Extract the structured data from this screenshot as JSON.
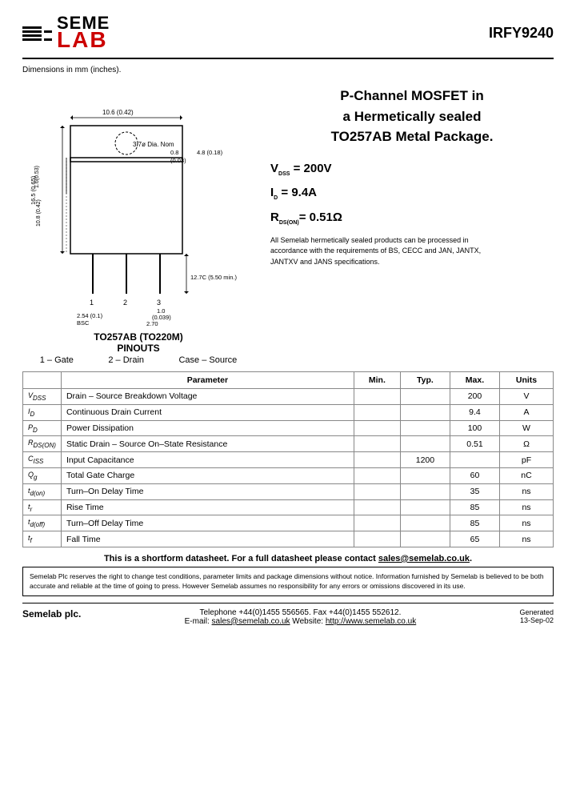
{
  "header": {
    "part_number": "IRFY9240",
    "logo_seme": "SEME",
    "logo_lab": "LAB"
  },
  "dim_note": "Dimensions in mm (inches).",
  "product": {
    "title_line1": "P-Channel MOSFET in",
    "title_line2": "a Hermetically sealed",
    "title_line3": "TO257AB Metal Package.",
    "vdss": "V",
    "vdss_label": "DSS",
    "vdss_value": "= 200V",
    "id_label": "D",
    "id_value": "= 9.4A",
    "rds_label": "DS(ON)",
    "rds_value": "= 0.51Ω",
    "compliance": "All Semelab hermetically sealed products can be processed in accordance with the requirements of BS, CECC and JAN, JANTX, JANTXV and JANS specifications."
  },
  "package": {
    "name": "TO257AB (TO220M)",
    "pinouts": "PINOUTS",
    "pin1": "1 – Gate",
    "pin2": "2 – Drain",
    "pin3": "Case – Source"
  },
  "table": {
    "headers": [
      "",
      "Parameter",
      "Min.",
      "Typ.",
      "Max.",
      "Units"
    ],
    "rows": [
      {
        "symbol": "V_DSS",
        "name": "Drain – Source Breakdown Voltage",
        "min": "",
        "typ": "",
        "max": "200",
        "units": "V"
      },
      {
        "symbol": "I_D",
        "name": "Continuous Drain Current",
        "min": "",
        "typ": "",
        "max": "9.4",
        "units": "A"
      },
      {
        "symbol": "P_D",
        "name": "Power Dissipation",
        "min": "",
        "typ": "",
        "max": "100",
        "units": "W"
      },
      {
        "symbol": "R_DS(ON)",
        "name": "Static Drain – Source On–State Resistance",
        "min": "",
        "typ": "",
        "max": "0.51",
        "units": "Ω"
      },
      {
        "symbol": "C_ISS",
        "name": "Input Capacitance",
        "min": "",
        "typ": "1200",
        "max": "",
        "units": "pF"
      },
      {
        "symbol": "Q_g",
        "name": "Total Gate Charge",
        "min": "",
        "typ": "",
        "max": "60",
        "units": "nC"
      },
      {
        "symbol": "t_d(on)",
        "name": "Turn–On Delay Time",
        "min": "",
        "typ": "",
        "max": "35",
        "units": "ns"
      },
      {
        "symbol": "t_r",
        "name": "Rise Time",
        "min": "",
        "typ": "",
        "max": "85",
        "units": "ns"
      },
      {
        "symbol": "t_d(off)",
        "name": "Turn–Off Delay Time",
        "min": "",
        "typ": "",
        "max": "85",
        "units": "ns"
      },
      {
        "symbol": "t_f",
        "name": "Fall Time",
        "min": "",
        "typ": "",
        "max": "65",
        "units": "ns"
      }
    ]
  },
  "shortform": {
    "text": "This is a shortform datasheet. For a full datasheet please contact ",
    "email": "sales@semelab.co.uk",
    "period": "."
  },
  "legal": "Semelab Plc reserves the right to change test conditions, parameter limits and package dimensions without notice. Information furnished by Semelab is believed to be both accurate and reliable at the time of going to press. However Semelab assumes no responsibility for any errors or omissions discovered in its use.",
  "footer": {
    "company": "Semelab plc.",
    "phone_label": "Telephone ",
    "phone": "+44(0)1455 556565.",
    "fax_label": " Fax ",
    "fax": "+44(0)1455 552612.",
    "email_label": "E-mail: ",
    "email": "sales@semelab.co.uk",
    "website_label": "  Website: ",
    "website": "http://www.semelab.co.uk",
    "generated_label": "Generated",
    "generated_date": "13-Sep-02"
  }
}
